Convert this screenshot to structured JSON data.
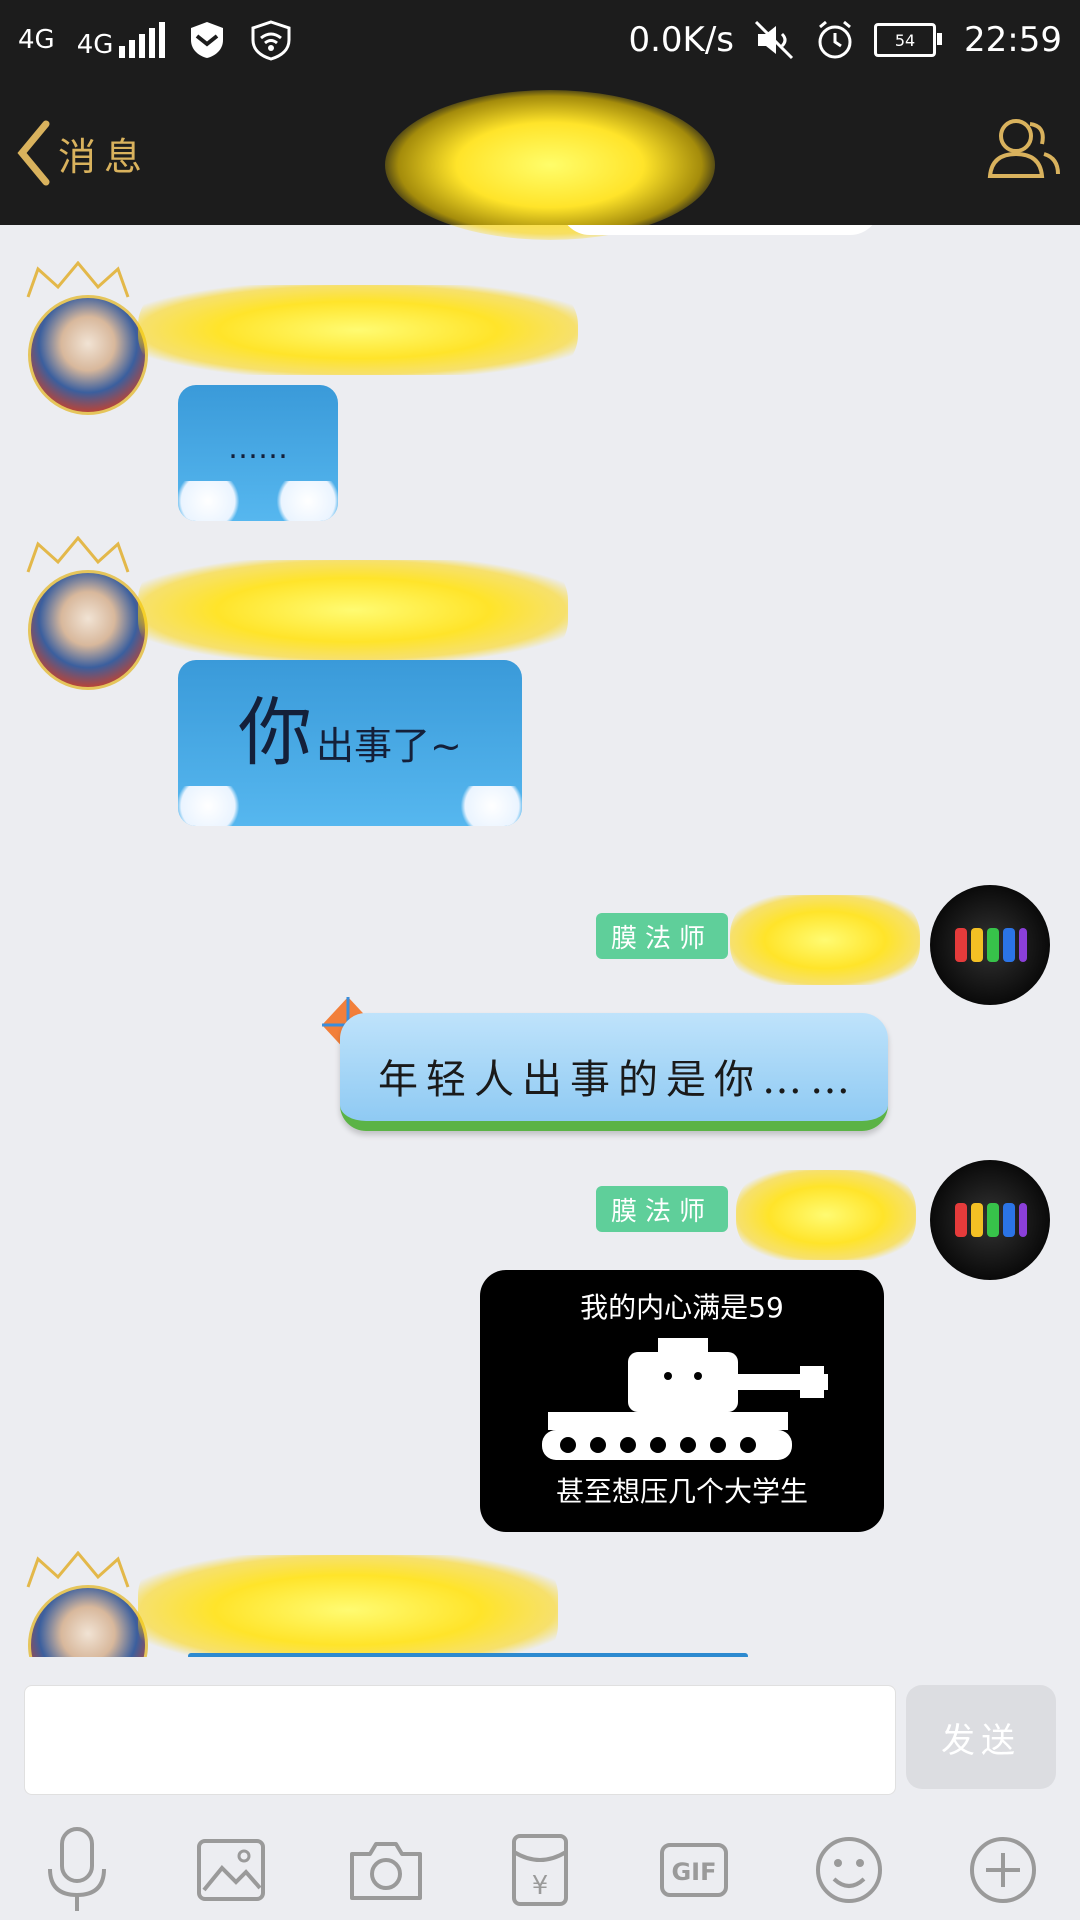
{
  "status_bar": {
    "network_1": "4G",
    "network_2": "4G",
    "speed": "0.0K/s",
    "battery": "54",
    "time": "22:59"
  },
  "header": {
    "back_label": "消息"
  },
  "messages": [
    {
      "side": "left",
      "sticker_text": "……"
    },
    {
      "side": "left",
      "sticker_big": "你",
      "sticker_small": "出事了~"
    },
    {
      "side": "right",
      "badge": "膜法师",
      "text": "年轻人出事的是你……"
    },
    {
      "side": "right",
      "badge": "膜法师",
      "meme_top": "我的内心满是59",
      "meme_bottom": "甚至想压几个大学生"
    }
  ],
  "input": {
    "placeholder": "",
    "send_label": "发送"
  },
  "toolbar": {
    "items": [
      "mic-icon",
      "image-icon",
      "camera-icon",
      "red-packet-icon",
      "gif-icon",
      "emoji-icon",
      "plus-icon"
    ],
    "gif_label": "GIF",
    "red_packet_label": "¥"
  },
  "colors": {
    "bar_bg": "#1c1c1c",
    "accent_gold": "#d9b25d",
    "badge_green": "#5fcf9a",
    "chat_bg": "#ecedf1"
  }
}
